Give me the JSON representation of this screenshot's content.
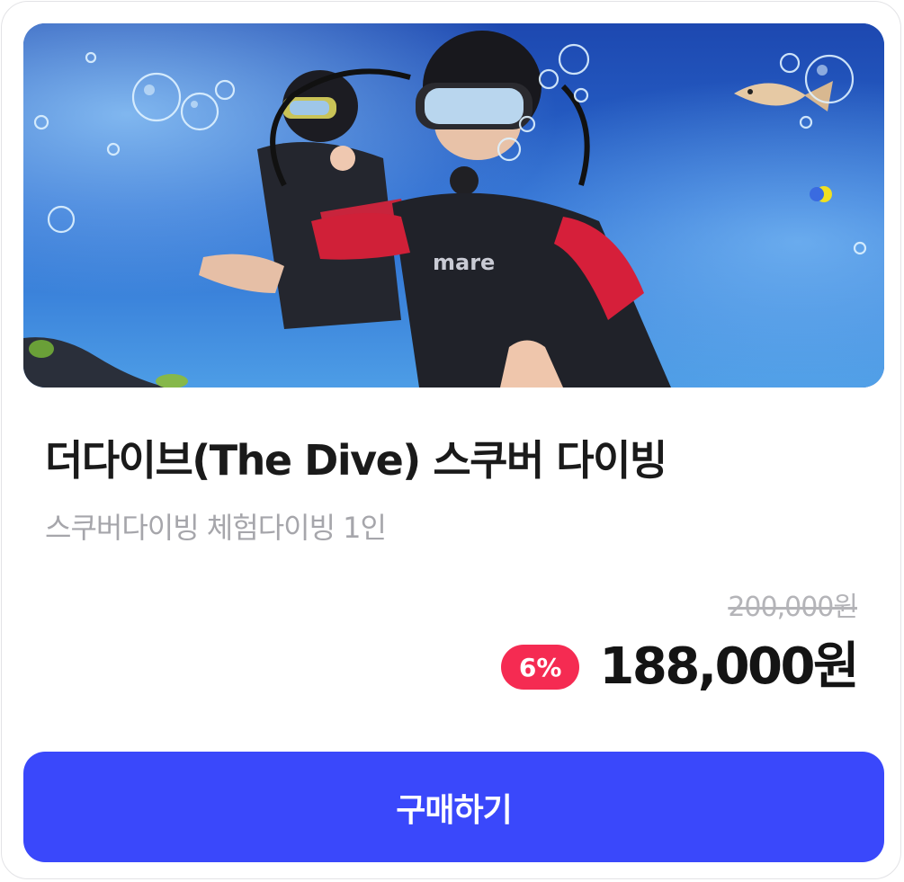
{
  "product": {
    "image_alt": "스쿠버 다이빙 체험 사진",
    "title": "더다이브(The Dive) 스쿠버 다이빙",
    "subtitle": "스쿠버다이빙 체험다이빙 1인",
    "original_price": "200,000원",
    "discount_rate": "6%",
    "sale_price": "188,000원",
    "wetsuit_logo": "mare"
  },
  "actions": {
    "buy_label": "구매하기"
  },
  "colors": {
    "accent": "#3a48fb",
    "discount": "#f52b52"
  }
}
